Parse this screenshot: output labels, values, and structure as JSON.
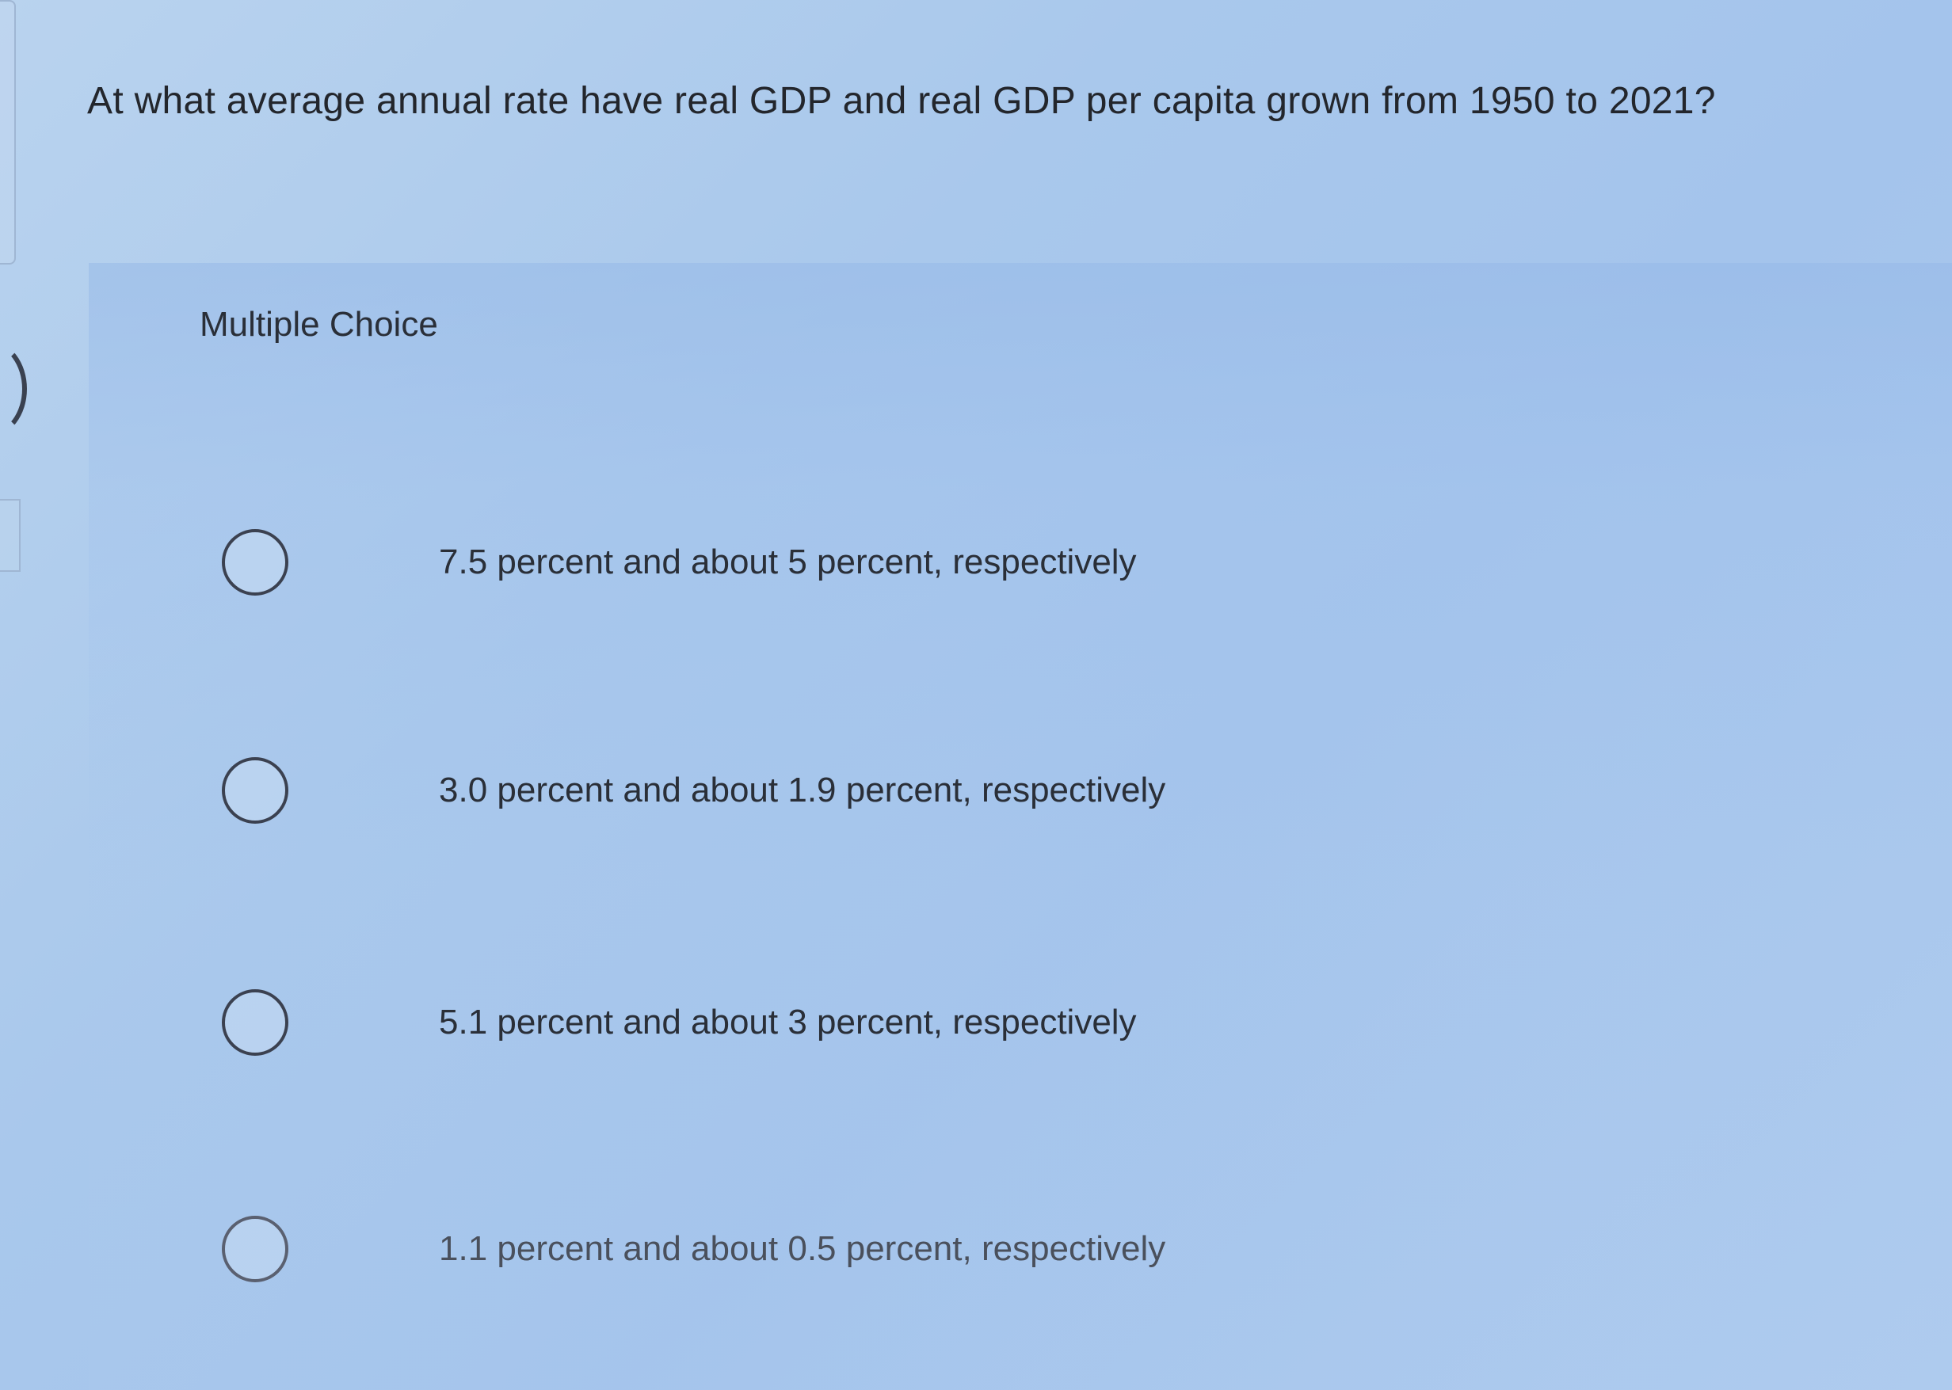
{
  "question": {
    "text": "At what average annual rate have real GDP and real GDP per capita grown from 1950 to 2021?"
  },
  "multiple_choice": {
    "label": "Multiple Choice",
    "options": [
      {
        "label": "7.5 percent and about 5 percent, respectively",
        "selected": false
      },
      {
        "label": "3.0 percent and about 1.9 percent, respectively",
        "selected": false
      },
      {
        "label": "5.1 percent and about 3 percent, respectively",
        "selected": false
      },
      {
        "label": "1.1 percent and about 0.5 percent, respectively",
        "selected": false
      }
    ]
  },
  "colors": {
    "background": "#aac8ec",
    "text": "#2a2f38",
    "radio_border": "#3b4150"
  }
}
